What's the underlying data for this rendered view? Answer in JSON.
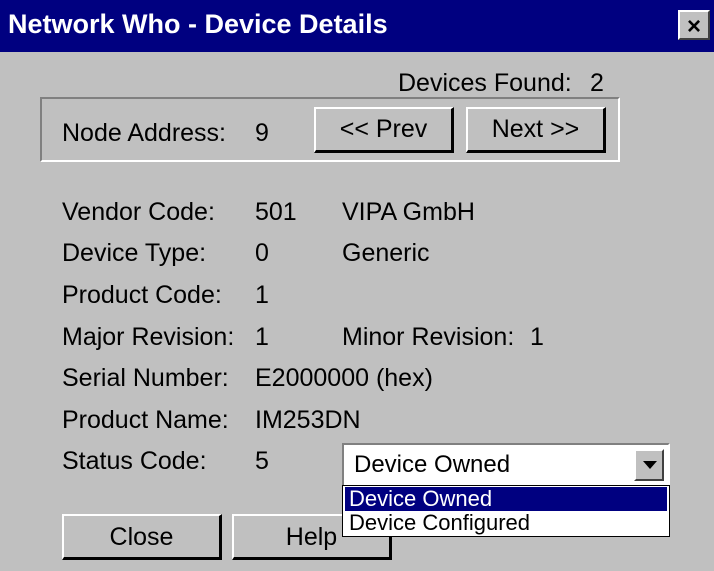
{
  "window": {
    "title": "Network Who - Device Details",
    "close_glyph": "×"
  },
  "devices_found": {
    "label": "Devices Found:",
    "value": "2"
  },
  "node": {
    "label": "Node Address:",
    "value": "9"
  },
  "nav": {
    "prev_label": "<< Prev",
    "next_label": "Next >>"
  },
  "fields": {
    "vendor": {
      "label": "Vendor Code:",
      "code": "501",
      "name": "VIPA GmbH"
    },
    "device_type": {
      "label": "Device Type:",
      "code": "0",
      "name": "Generic"
    },
    "product_code": {
      "label": "Product Code:",
      "value": "1"
    },
    "major_rev": {
      "label": "Major Revision:",
      "value": "1"
    },
    "minor_rev": {
      "label": "Minor Revision:",
      "value": "1"
    },
    "serial": {
      "label": "Serial Number:",
      "value": "E2000000 (hex)"
    },
    "product_name": {
      "label": "Product Name:",
      "value": "IM253DN"
    },
    "status": {
      "label": "Status Code:",
      "value": "5"
    }
  },
  "status_select": {
    "selected": "Device Owned",
    "options": [
      "Device Owned",
      "Device Configured"
    ]
  },
  "buttons": {
    "close_label": "Close",
    "help_label": "Help"
  }
}
